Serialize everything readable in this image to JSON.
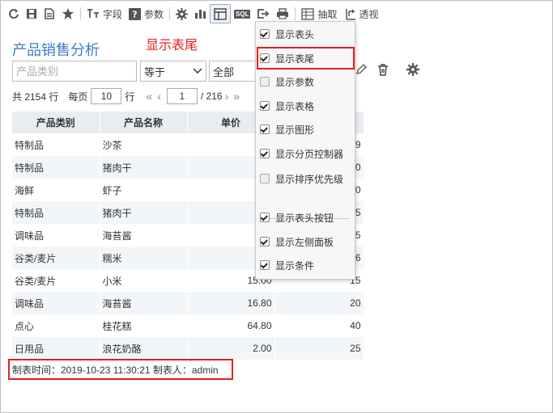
{
  "toolbar": {
    "fields_label": "字段",
    "params_label": "参数",
    "drill_label": "抽取",
    "pivot_label": "透视",
    "sql_text": "SQL"
  },
  "report": {
    "title": "产品销售分析",
    "annotation": "显示表尾"
  },
  "filters": {
    "category_placeholder": "产品类别",
    "operator": "等于",
    "value": "全部"
  },
  "pager": {
    "total_prefix": "共 2154 行",
    "per_page_label": "每页",
    "per_page": "10",
    "rows_unit": "行",
    "current_page": "1",
    "total_pages": "/ 216"
  },
  "table": {
    "columns": [
      "产品类别",
      "产品名称",
      "单价"
    ],
    "rows": [
      [
        "特制品",
        "沙茶",
        "18",
        "9"
      ],
      [
        "特制品",
        "猪肉干",
        "42",
        "0"
      ],
      [
        "海鲜",
        "虾子",
        "7",
        "0"
      ],
      [
        "特制品",
        "猪肉干",
        "42",
        "5"
      ],
      [
        "调味品",
        "海苔酱",
        "16",
        "5"
      ],
      [
        "谷类/麦片",
        "糯米",
        "16",
        "6"
      ],
      [
        "谷类/麦片",
        "小米",
        "15.00",
        "15"
      ],
      [
        "调味品",
        "海苔酱",
        "16.80",
        "20"
      ],
      [
        "点心",
        "桂花糕",
        "64.80",
        "40"
      ],
      [
        "日用品",
        "浪花奶酪",
        "2.00",
        "25"
      ]
    ]
  },
  "footer": {
    "text": "制表时间：2019-10-23 11:30:21 制表人：admin"
  },
  "menu": {
    "items": [
      {
        "label": "显示表头",
        "checked": true
      },
      {
        "label": "显示表尾",
        "checked": true
      },
      {
        "label": "显示参数",
        "checked": false
      },
      {
        "label": "显示表格",
        "checked": true
      },
      {
        "label": "显示图形",
        "checked": true
      },
      {
        "label": "显示分页控制器",
        "checked": true
      },
      {
        "label": "显示排序优先级",
        "checked": false
      },
      {
        "label": "显示表头按钮",
        "checked": true
      },
      {
        "label": "显示左侧面板",
        "checked": true
      },
      {
        "label": "显示条件",
        "checked": true
      }
    ]
  },
  "colors": {
    "accent_title": "#3d7cc9",
    "annotation_red": "#e02020",
    "header_bg": "#e9edf2"
  }
}
